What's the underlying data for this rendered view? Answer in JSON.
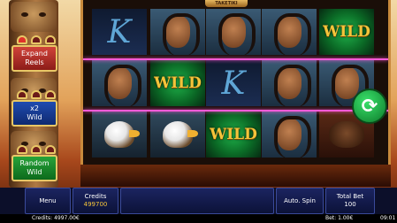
{
  "logo": "TAKETIKI",
  "features": [
    {
      "label": "Expand\nReels",
      "hearts_lit": 1
    },
    {
      "label": "x2\nWild",
      "hearts_lit": 0
    },
    {
      "label": "Random\nWild",
      "hearts_lit": 0
    }
  ],
  "reels": [
    [
      "k",
      "chief",
      "eagle"
    ],
    [
      "chief",
      "wild",
      "eagle"
    ],
    [
      "chief",
      "k",
      "wild"
    ],
    [
      "chief",
      "chief",
      "chief"
    ],
    [
      "wild",
      "chief",
      "bison"
    ]
  ],
  "symbols": {
    "k": "K",
    "wild": "WILD"
  },
  "buttons": {
    "menu": "Menu",
    "autospin": "Auto. Spin"
  },
  "credits": {
    "label": "Credits",
    "value": "499700"
  },
  "total_bet": {
    "label": "Total Bet",
    "value": "100"
  },
  "info": {
    "credits": "Credits: 4997.00€",
    "bet": "Bet: 1.00€",
    "time": "09:01"
  },
  "colors": {
    "accent": "#f4c43a",
    "win_line": "#ff5ad8",
    "spin": "#1fb24a"
  }
}
